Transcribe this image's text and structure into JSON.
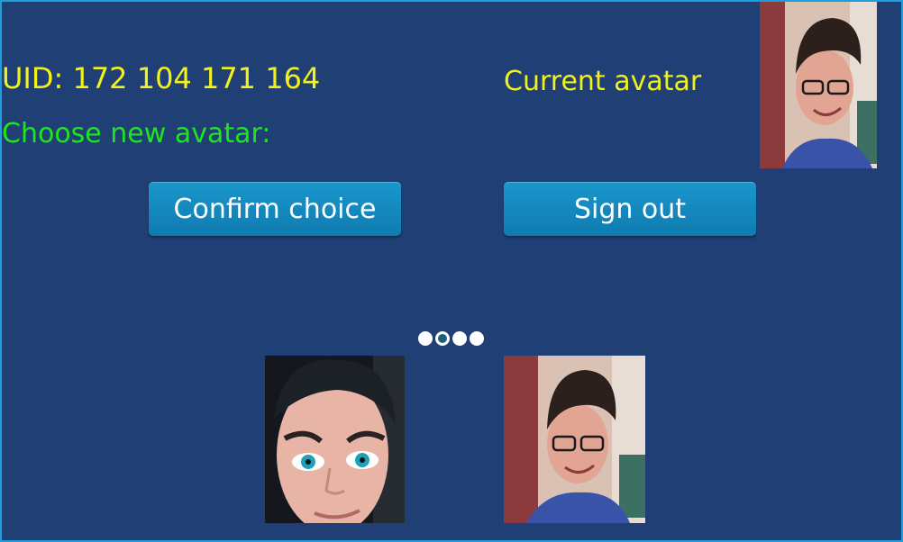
{
  "profile": {
    "uid_text": "UID: 172 104 171 164",
    "choose_label": "Choose new avatar:",
    "current_label": "Current avatar",
    "current_avatar": "avatar-glasses-smiling"
  },
  "buttons": {
    "confirm_label": "Confirm choice",
    "signout_label": "Sign out"
  },
  "carousel": {
    "page_count": 4,
    "active_page": 2,
    "avatars": [
      "avatar-blue-eyes-closeup",
      "avatar-glasses-smiling"
    ]
  },
  "colors": {
    "background": "#203f75",
    "border": "#1e9fdc",
    "uid_text": "#f2f21a",
    "choose_text": "#1de61d",
    "button": "#1a97cc"
  }
}
